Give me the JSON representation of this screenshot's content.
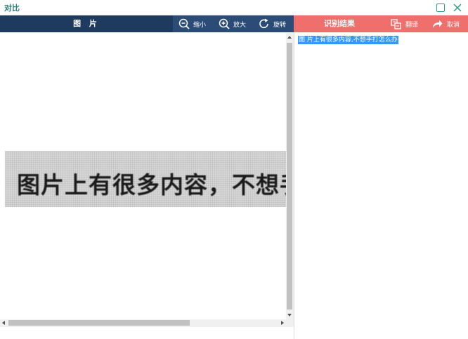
{
  "window": {
    "title": "对比"
  },
  "image_panel": {
    "title": "图 片",
    "toolbar": {
      "zoom_out": "缩小",
      "zoom_in": "放大",
      "rotate": "旋转"
    },
    "photo_text": "图片上有很多内容，不想手"
  },
  "result_panel": {
    "title": "识别结果",
    "translate": "翻译",
    "cancel": "取消",
    "text": "图   片上有很多内容,不想手打怎么办"
  },
  "colors": {
    "left_header": "#1f3a5f",
    "left_toolbar": "#2b4c76",
    "right_header": "#ef6f6c",
    "selection": "#3399ff",
    "title_text": "#2a7f78"
  }
}
